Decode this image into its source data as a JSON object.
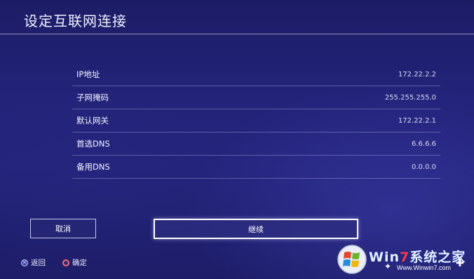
{
  "header": {
    "title": "设定互联网连接"
  },
  "fields": [
    {
      "label": "IP地址",
      "value": "172.22.2.2"
    },
    {
      "label": "子网掩码",
      "value": "255.255.255.0"
    },
    {
      "label": "默认网关",
      "value": "172.22.2.1"
    },
    {
      "label": "首选DNS",
      "value": "6.6.6.6"
    },
    {
      "label": "备用DNS",
      "value": "0.0.0.0"
    }
  ],
  "buttons": {
    "cancel": "取消",
    "continue": "继续"
  },
  "hints": {
    "back": "返回",
    "confirm": "确定"
  },
  "watermark": {
    "brand_prefix": "Win",
    "brand_seven": "7",
    "brand_suffix": "系统之家",
    "url": "Www.Winwin7.com"
  },
  "colors": {
    "background": "#23237a",
    "focus_border": "#ffffff",
    "confirm_circle": "#ff6a6a"
  }
}
